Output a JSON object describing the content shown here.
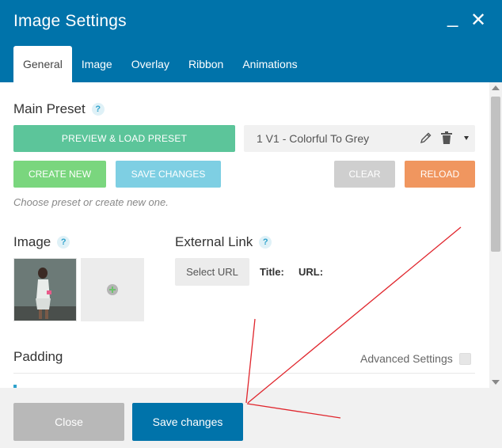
{
  "window": {
    "title": "Image Settings",
    "minimize_glyph": "_",
    "close_glyph": "✕"
  },
  "tabs": [
    {
      "label": "General",
      "active": true
    },
    {
      "label": "Image",
      "active": false
    },
    {
      "label": "Overlay",
      "active": false
    },
    {
      "label": "Ribbon",
      "active": false
    },
    {
      "label": "Animations",
      "active": false
    }
  ],
  "main_preset": {
    "title": "Main Preset",
    "help": "?",
    "preview_load_label": "PREVIEW & LOAD PRESET",
    "selected_preset": "1 V1 - Colorful To Grey",
    "create_new_label": "CREATE NEW",
    "save_changes_label": "SAVE CHANGES",
    "clear_label": "CLEAR",
    "reload_label": "RELOAD",
    "hint": "Choose preset or create new one."
  },
  "image": {
    "title": "Image",
    "help": "?"
  },
  "external_link": {
    "title": "External Link",
    "help": "?",
    "select_url_label": "Select URL",
    "title_label": "Title:",
    "url_label": "URL:"
  },
  "padding": {
    "title": "Padding",
    "advanced_settings_label": "Advanced Settings"
  },
  "footer": {
    "close_label": "Close",
    "save_changes_label": "Save changes"
  },
  "colors": {
    "header": "#0073aa",
    "preview_button": "#5cc59a",
    "create_button": "#7ad67e",
    "save_button": "#7ecfe3",
    "clear_button": "#cfcfcf",
    "reload_button": "#f0965f",
    "annotation_arrow": "#e0252c"
  },
  "icons": [
    "minimize-icon",
    "close-icon",
    "help-icon",
    "pencil-icon",
    "trash-icon",
    "caret-down-icon",
    "plus-icon"
  ]
}
